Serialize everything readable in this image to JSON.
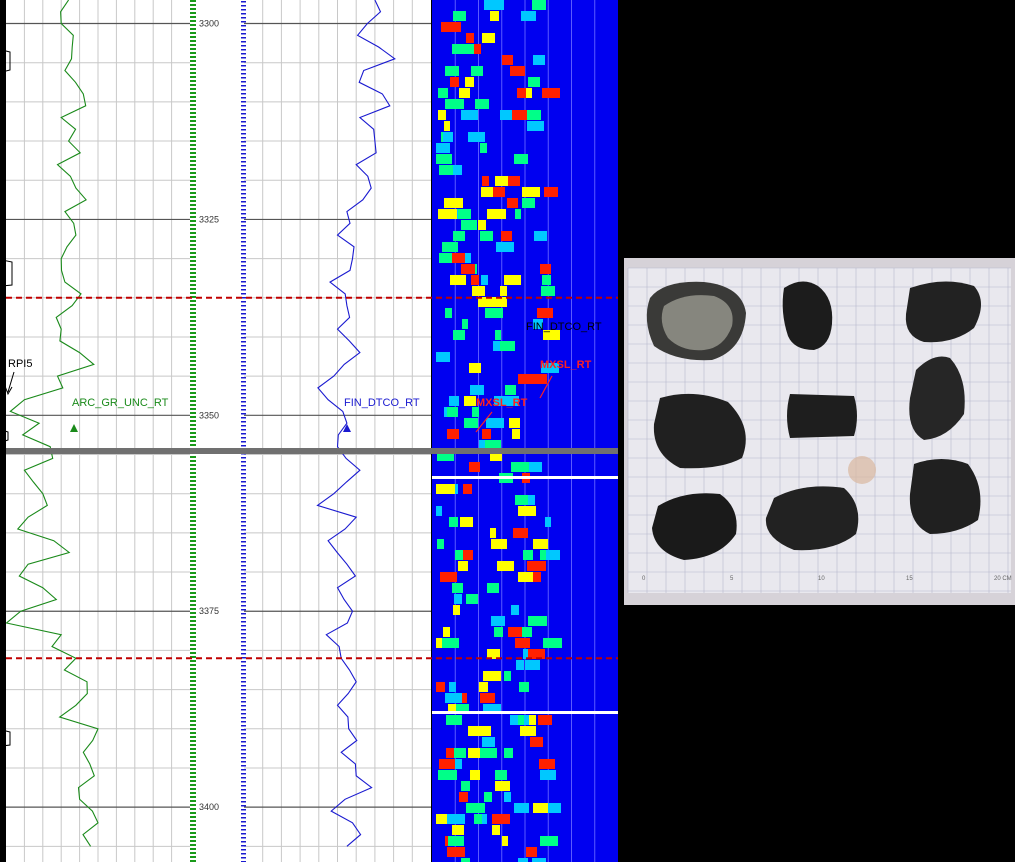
{
  "chart_data": {
    "type": "line",
    "title": "",
    "depth_axis": {
      "ticks": [
        3300,
        3325,
        3350,
        3375,
        3400
      ],
      "ylim": [
        3297,
        3407
      ],
      "direction": "down"
    },
    "markers": {
      "depths": [
        3335,
        3381
      ],
      "color": "#c00000",
      "style": "dashed"
    },
    "section_break_depth": 3355.4,
    "curve_labels": {
      "gamma_ray": "ARC_GR_UNC_RT",
      "sonic": "FIN_DTCO_RT",
      "rpi": "RPI5",
      "spectrum_dtco": "FIN_DTCO_RT",
      "spectrum_mxsl": "MXSL_RT",
      "spectrum_mxsl_2": "MXSL_RT"
    },
    "series": [
      {
        "name": "ARC_GR_UNC_RT",
        "color": "#1a8a1a",
        "depth": [
          3297,
          3300,
          3303,
          3306,
          3309,
          3312,
          3315,
          3318,
          3321,
          3324,
          3327,
          3330,
          3333,
          3336,
          3339,
          3342,
          3345,
          3348,
          3351,
          3354,
          3357,
          3360,
          3363,
          3366,
          3369,
          3372,
          3375,
          3378,
          3381,
          3384,
          3387,
          3390,
          3393,
          3396,
          3399,
          3402,
          3405
        ],
        "values": [
          0.34,
          0.3,
          0.36,
          0.32,
          0.42,
          0.3,
          0.34,
          0.28,
          0.38,
          0.32,
          0.38,
          0.3,
          0.32,
          0.36,
          0.3,
          0.4,
          0.28,
          0.1,
          0.18,
          0.24,
          0.1,
          0.2,
          0.12,
          0.26,
          0.12,
          0.2,
          0.08,
          0.3,
          0.38,
          0.44,
          0.38,
          0.5,
          0.42,
          0.48,
          0.4,
          0.5,
          0.46
        ]
      },
      {
        "name": "FIN_DTCO_RT",
        "color": "#1a1ad0",
        "depth": [
          3297,
          3300,
          3303,
          3306,
          3309,
          3312,
          3315,
          3318,
          3321,
          3324,
          3327,
          3330,
          3333,
          3336,
          3339,
          3342,
          3345,
          3348,
          3351,
          3354,
          3357,
          3360,
          3363,
          3366,
          3369,
          3372,
          3375,
          3378,
          3381,
          3384,
          3387,
          3390,
          3393,
          3396,
          3399,
          3402,
          3405
        ],
        "values": [
          0.7,
          0.66,
          0.72,
          0.64,
          0.74,
          0.62,
          0.7,
          0.6,
          0.68,
          0.55,
          0.5,
          0.58,
          0.46,
          0.55,
          0.5,
          0.62,
          0.48,
          0.45,
          0.55,
          0.5,
          0.62,
          0.48,
          0.6,
          0.45,
          0.55,
          0.5,
          0.58,
          0.44,
          0.52,
          0.6,
          0.5,
          0.56,
          0.52,
          0.6,
          0.54,
          0.58,
          0.55
        ]
      }
    ],
    "spectrum": {
      "colors": [
        "#0000ff",
        "#00c8ff",
        "#00ff88",
        "#ffff00",
        "#ff2000"
      ]
    }
  },
  "core_photo": {
    "scale_labels": [
      "0",
      "5",
      "10",
      "15",
      "20 CM"
    ]
  }
}
